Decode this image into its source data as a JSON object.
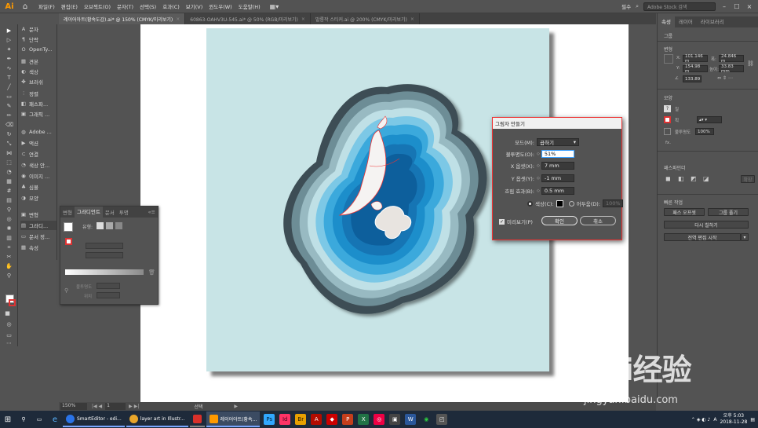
{
  "menubar": {
    "logo": "Ai",
    "items": [
      "파일(F)",
      "편집(E)",
      "오브젝트(O)",
      "문자(T)",
      "선택(S)",
      "효과(C)",
      "보기(V)",
      "윈도우(W)",
      "도움말(H)"
    ],
    "workspace": "필수",
    "stock_search_placeholder": "Adobe Stock 검색"
  },
  "tabs": [
    {
      "label": "레이어아트(황속도감).ai* @ 150% (CMYK/미리보기)",
      "active": true
    },
    {
      "label": "60863-OAHV3U-545.ai* @ 50% (RGB/미리보기)",
      "active": false
    },
    {
      "label": "발롱작 스티커.ai @ 200% (CMYK/미리보기)",
      "active": false
    }
  ],
  "dock": {
    "items": [
      "문자",
      "단락",
      "OpenTy...",
      "견본",
      "색상",
      "브러쉬",
      "정렬",
      "패스파...",
      "그래픽 ...",
      "Adobe ...",
      "액션",
      "연결",
      "색상 안...",
      "이미지 ...",
      "심볼",
      "모양",
      "변형",
      "그라디...",
      "문서 정...",
      "속성"
    ]
  },
  "gradient_panel": {
    "tabs": [
      "변형",
      "그라디언트",
      "문서",
      "투명"
    ],
    "type_label": "유형:",
    "opacity_label": "불투명도",
    "location_label": "위치"
  },
  "dialog": {
    "title": "그림자 만들기",
    "mode_label": "모드(M):",
    "mode_value": "곱하기",
    "opacity_label": "불투명도(O):",
    "opacity_value": "51%",
    "x_label": "X 옵셋(X):",
    "x_value": "7 mm",
    "y_label": "Y 옵셋(Y):",
    "y_value": "-1 mm",
    "blur_label": "흐림 효과(B):",
    "blur_value": "0.5 mm",
    "color_label": "색상(C):",
    "darkness_label": "어두움(D):",
    "darkness_value": "100%",
    "preview_label": "미리보기(P)",
    "ok_label": "확인",
    "cancel_label": "취소"
  },
  "properties": {
    "tabs": [
      "속성",
      "레이어",
      "라이브러리"
    ],
    "group_label": "그룹",
    "transform_label": "변형",
    "x_label": "X:",
    "x_value": "101.146 m",
    "y_label": "Y:",
    "y_value": "154.98 m",
    "w_label": "폭:",
    "w_value": "24.846 m",
    "h_label": "높이:",
    "h_value": "33.83 mm",
    "angle_value": "133.89",
    "appearance_label": "모양",
    "fill_label": "칠",
    "stroke_label": "획",
    "opacity_label": "불투명도",
    "opacity_value": "100%",
    "fx_label": "fx.",
    "pathfinder_label": "패스파인더",
    "expand_label": "확장",
    "quick_actions_label": "빠른 작업",
    "quick_buttons": [
      "패스 오프셋",
      "그룹 풀기",
      "다시 칠하기",
      "전역 편집 시작"
    ]
  },
  "status": {
    "zoom": "150%",
    "page": "1",
    "tool": "선택"
  },
  "taskbar": {
    "apps": [
      {
        "label": "SmartEditor - edi...",
        "color": "#2a73e8",
        "active": false
      },
      {
        "label": "layer art in Illustr...",
        "color": "#e8a52a",
        "active": false
      },
      {
        "label": "",
        "color": "#d9302a",
        "active": false
      },
      {
        "label": "레이어아트(황속...",
        "color": "#ff9a00",
        "active": true
      }
    ],
    "lang": "A",
    "time": "오후 5:03",
    "date": "2018-11-28"
  },
  "watermark": {
    "brand": "Bai经验",
    "url": "jingyan.baidu.com"
  },
  "colors": {
    "accent": "#ff9a00",
    "background": "#535353",
    "canvas_bg": "#c8e4e6"
  }
}
